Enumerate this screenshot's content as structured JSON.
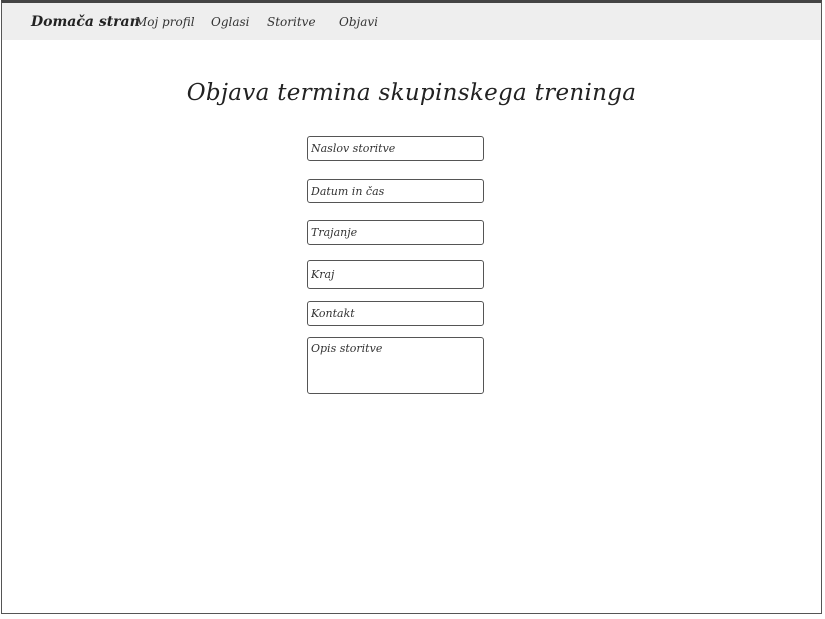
{
  "nav": {
    "brand": "Domača stran",
    "items": [
      {
        "label": "Moj profil"
      },
      {
        "label": "Oglasi"
      },
      {
        "label": "Storitve"
      },
      {
        "label": "Objavi"
      }
    ]
  },
  "page": {
    "title": "Objava termina skupinskega treninga"
  },
  "form": {
    "title_placeholder": "Naslov storitve",
    "datetime_placeholder": "Datum in čas",
    "duration_placeholder": "Trajanje",
    "location_placeholder": "Kraj",
    "contact_placeholder": "Kontakt",
    "description_placeholder": "Opis storitve"
  }
}
